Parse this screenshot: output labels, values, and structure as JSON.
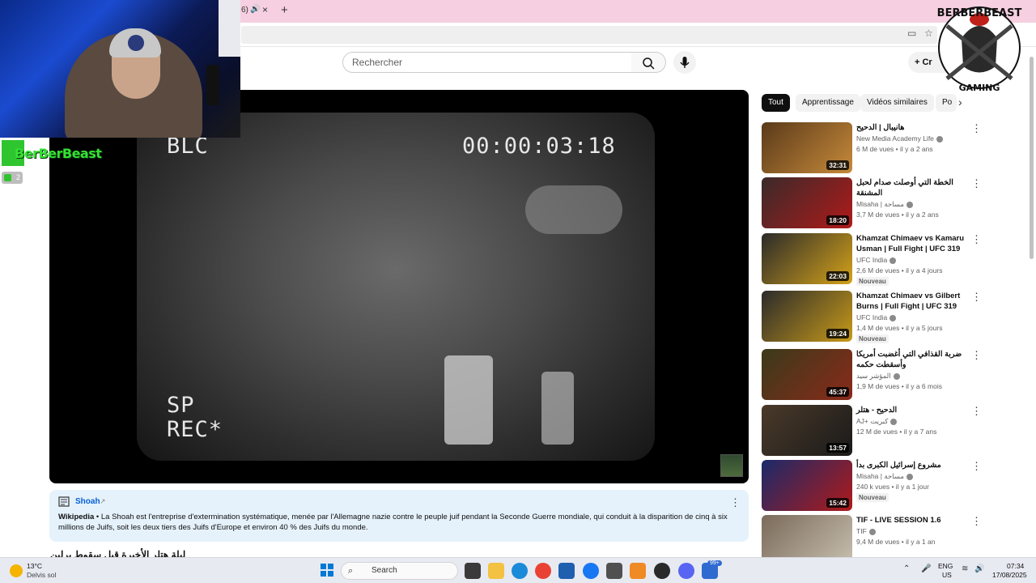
{
  "browser": {
    "tab_fragment": "6)",
    "tab_close_icon": "×",
    "new_tab_icon": "+"
  },
  "header": {
    "search_placeholder": "Rechercher",
    "create_label": "Cr"
  },
  "player": {
    "overlay_tl": "BLC",
    "overlay_timecode": "00:00:03:18",
    "overlay_bl_1": "SP",
    "overlay_bl_2": "REC*"
  },
  "streamer": {
    "tag": "BerBerBeast",
    "badge_count": "2"
  },
  "info_panel": {
    "title": "Shoah",
    "source": "Wikipedia",
    "text": " • La Shoah est l'entreprise d'extermination systématique, menée par l'Allemagne nazie contre le peuple juif pendant la Seconde Guerre mondiale, qui conduit à la disparition de cinq à six millions de Juifs, soit les deux tiers des Juifs d'Europe et environ 40 % des Juifs du monde."
  },
  "next_video_title": "ليلة هتلر الأخيرة قبل سقوط برلين",
  "chips": [
    {
      "label": "Tout",
      "active": true
    },
    {
      "label": "Apprentissage"
    },
    {
      "label": "Vidéos similaires"
    },
    {
      "label": "Po"
    }
  ],
  "recommendations": [
    {
      "title": "هانيبال | الدحيح",
      "channel": "New Media Academy Life",
      "meta": "6 M de vues • il y a 2 ans",
      "duration": "32:31",
      "thumb_colors": [
        "#5a3a1a",
        "#c78a3a"
      ]
    },
    {
      "title": "الخطة التي أوصلت صدام لحبل المشنقة",
      "channel": "Misaha | مساحة",
      "meta": "3,7 M de vues • il y a 2 ans",
      "duration": "18:20",
      "thumb_colors": [
        "#3a2a2a",
        "#b01a1a"
      ]
    },
    {
      "title": "Khamzat Chimaev vs Kamaru Usman | Full Fight | UFC 319",
      "channel": "UFC India",
      "meta": "2,6 M de vues • il y a 4 jours",
      "badge": "Nouveau",
      "duration": "22:03",
      "thumb_colors": [
        "#2a2a2a",
        "#d4a21a"
      ]
    },
    {
      "title": "Khamzat Chimaev vs Gilbert Burns | Full Fight | UFC 319",
      "channel": "UFC India",
      "meta": "1,4 M de vues • il y a 5 jours",
      "badge": "Nouveau",
      "duration": "19:24",
      "thumb_colors": [
        "#2a2a2a",
        "#c89a1a"
      ]
    },
    {
      "title": "ضربة القذافي التي أغضبت أمريكا وأسقطت حكمه",
      "channel": "المؤشر سيد",
      "meta": "1,9 M de vues • il y a 6 mois",
      "duration": "45:37",
      "thumb_colors": [
        "#3a3a1a",
        "#8a2a1a"
      ]
    },
    {
      "title": "الدحيح - هتلر",
      "channel": "AJ+ كبريت",
      "meta": "12 M de vues • il y a 7 ans",
      "duration": "13:57",
      "thumb_colors": [
        "#4a3a2a",
        "#1a1a1a"
      ]
    },
    {
      "title": "مشروع إسرائيل الكبرى بدأ",
      "channel": "Misaha | مساحة",
      "meta": "240 k vues • il y a 1 jour",
      "badge": "Nouveau",
      "duration": "15:42",
      "thumb_colors": [
        "#1a2a6a",
        "#b01a1a"
      ]
    },
    {
      "title": "TIF - LIVE SESSION 1.6",
      "channel": "TIF",
      "meta": "9,4 M de vues • il y a 1 an",
      "duration": "",
      "thumb_colors": [
        "#7a6a5a",
        "#c8c0b0"
      ]
    }
  ],
  "taskbar": {
    "weather_temp": "13°C",
    "weather_desc": "Delvis sol",
    "search_label": "Search",
    "badge": "99+",
    "lang_1": "ENG",
    "lang_2": "US",
    "time": "07:34",
    "date": "17/08/2025"
  }
}
